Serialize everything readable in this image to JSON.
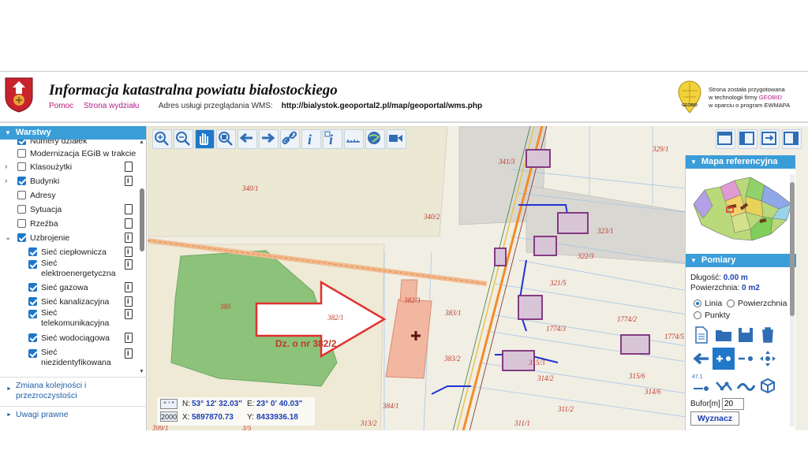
{
  "header": {
    "title": "Informacja katastralna powiatu białostockiego",
    "help": "Pomoc",
    "department": "Strona wydziału",
    "wms_label": "Adres usługi przeglądania WMS:",
    "wms_url": "http://bialystok.geoportal2.pl/map/geoportal/wms.php",
    "credit_line1": "Strona została przygotowana",
    "credit_line2_a": "w technologii firmy ",
    "credit_line2_b": "GEOBID",
    "credit_line3": "w oparciu o program EWMAPA",
    "logo_text": "GEOBID"
  },
  "sidebar": {
    "title": "Warstwy",
    "layers": [
      {
        "label": "Numery działek",
        "checked": true,
        "icon": ""
      },
      {
        "label": "Modernizacja EGiB w trakcie",
        "checked": false,
        "icon": ""
      },
      {
        "label": "Klasoużytki",
        "checked": false,
        "icon": "doc",
        "expandable": true
      },
      {
        "label": "Budynki",
        "checked": true,
        "icon": "info",
        "expandable": true
      },
      {
        "label": "Adresy",
        "checked": false,
        "icon": ""
      },
      {
        "label": "Sytuacja",
        "checked": false,
        "icon": "doc"
      },
      {
        "label": "Rzeźba",
        "checked": false,
        "icon": "doc"
      },
      {
        "label": "Uzbrojenie",
        "checked": true,
        "icon": "info",
        "expandable": true,
        "expanded": true
      },
      {
        "label": "Sieć ciepłownicza",
        "checked": true,
        "icon": "info",
        "child": true
      },
      {
        "label": "Sieć elektroenergetyczna",
        "label1": "Sieć",
        "label2": "elektroenergetyczna",
        "checked": true,
        "icon": "info",
        "child": true
      },
      {
        "label": "Sieć gazowa",
        "checked": true,
        "icon": "info",
        "child": true
      },
      {
        "label": "Sieć kanalizacyjna",
        "checked": true,
        "icon": "info",
        "child": true
      },
      {
        "label": "Sieć telekomunikacyjna",
        "label1": "Sieć",
        "label2": "telekomunikacyjna",
        "checked": true,
        "icon": "info",
        "child": true
      },
      {
        "label": "Sieć wodociągowa",
        "checked": true,
        "icon": "info",
        "child": true
      },
      {
        "label": "Sieć niezidentyfikowana",
        "label1": "Sieć",
        "label2": "niezidentyfikowana",
        "checked": true,
        "icon": "info",
        "child": true
      }
    ],
    "reorder_l1": "Zmiana kolejności i",
    "reorder_l2": "przezroczystości",
    "legal": "Uwagi prawne"
  },
  "map": {
    "annotation": "Dz. o nr 382/2",
    "parcels": [
      "340/1",
      "340/2",
      "341/3",
      "329/1",
      "323/1",
      "322/3",
      "321/5",
      "1774/3",
      "1774/2",
      "1774/5",
      "382/3",
      "382/1",
      "383/1",
      "383/2",
      "315/3",
      "314/2",
      "315/6",
      "314/6",
      "311/2",
      "311/1",
      "313/2",
      "384/1",
      "385",
      "399/1",
      "3/5"
    ],
    "colors": {
      "road": "#f28c28",
      "gas": "#e4c64a",
      "water": "#1f33d1",
      "building": "#7a2a78",
      "target_parcel": "#f2b7a0",
      "forest": "#8dc27a",
      "arrow": "#e0312f"
    }
  },
  "coords": {
    "n_label": "N:",
    "n_value": "53° 12' 32.03\"",
    "e_label": "E:",
    "e_value": "23° 0' 40.03\"",
    "x_label": "X:",
    "x_value": "5897870.73",
    "y_label": "Y:",
    "y_value": "8433936.18",
    "mode_top": "° ' \"",
    "mode_bottom": "2000"
  },
  "right_panel": {
    "ref_title": "Mapa referencyjna",
    "measure_title": "Pomiary",
    "length_label": "Długość:",
    "length_value": "0.00 m",
    "area_label": "Powierzchnia:",
    "area_value": "0 m2",
    "opt_line": "Linia",
    "opt_area": "Powierzchnia",
    "opt_points": "Punkty",
    "selected_option": "Linia",
    "buffer_label": "Bufor[m]",
    "buffer_value": "20",
    "calc_button": "Wyznacz",
    "small_label": "47.1"
  }
}
